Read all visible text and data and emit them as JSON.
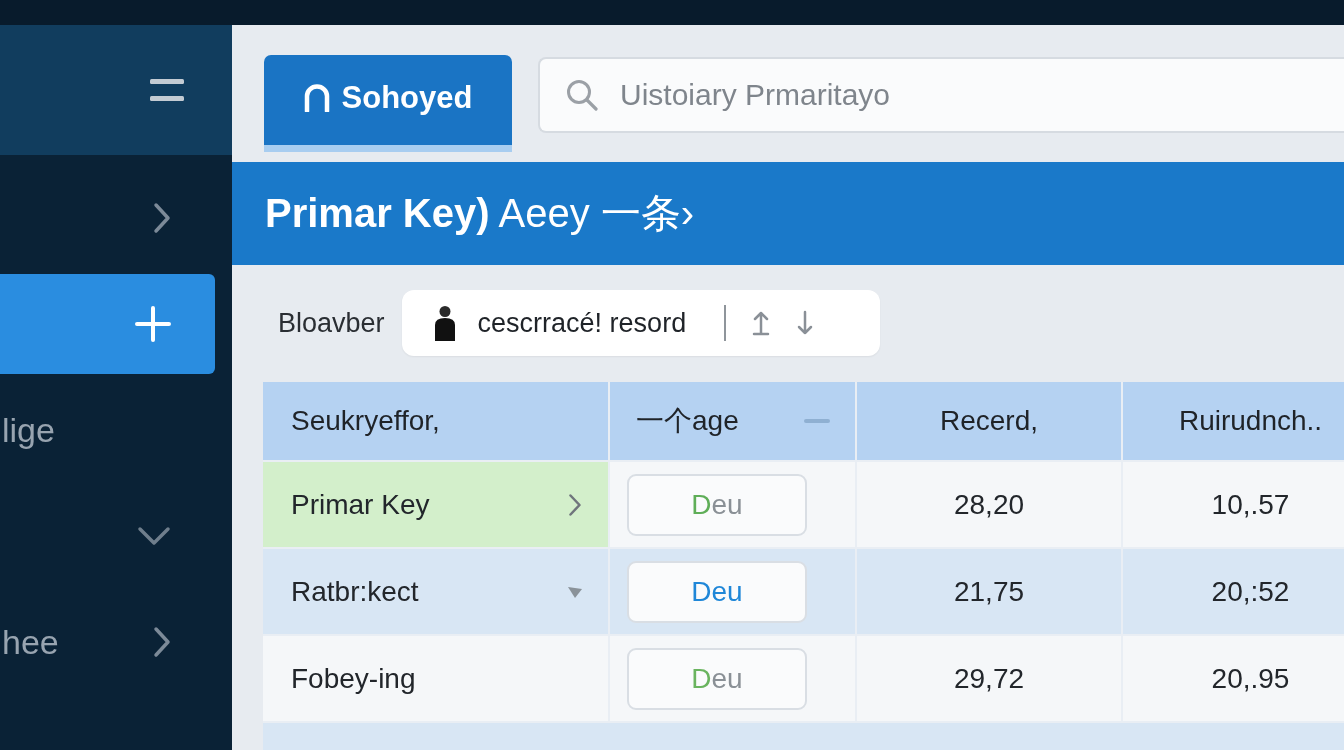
{
  "sidebar": {
    "items": [
      {
        "kind": "expand",
        "selected": false
      },
      {
        "kind": "add",
        "selected": true
      },
      {
        "label": "lige",
        "kind": "link",
        "selected": false
      },
      {
        "kind": "collapse",
        "selected": false
      },
      {
        "label": "hee",
        "kind": "expand",
        "selected": false
      }
    ]
  },
  "tabs": [
    {
      "label": "Sohoyed",
      "selected": true
    }
  ],
  "search": {
    "placeholder": "Uistoiary Prmaritayo"
  },
  "title": "**Primar Key)** Aeey 一条›",
  "toolbar": {
    "label": "Bloavber",
    "filter": {
      "value": "cescrracé! resord"
    }
  },
  "table": {
    "columns": [
      {
        "label": "Seukryeffor,",
        "kind": "plain"
      },
      {
        "label": "一个age",
        "kind": "collapsible"
      },
      {
        "label": "Recerd,",
        "kind": "plain"
      },
      {
        "label": "Ruirudnch..",
        "kind": "plain"
      }
    ],
    "rows": [
      {
        "kind": "expandable",
        "selected": true,
        "column_1": "Primar Key",
        "column_2": {
          "text": "Deu",
          "kind": "initial",
          "color": "#5fae58"
        },
        "column_3": "28,20",
        "column_4": "10,.57"
      },
      {
        "kind": "dropdown",
        "selected": false,
        "column_1": "Ratbr:kect",
        "column_2": {
          "text": "Deu",
          "kind": "full",
          "color": "#1f87d8"
        },
        "column_3": "21,75",
        "column_4": "20,:52"
      },
      {
        "kind": "plain",
        "selected": false,
        "column_1": "Fobey-ing",
        "column_2": {
          "text": "Deu",
          "kind": "initial",
          "color": "#6ab45f"
        },
        "column_3": "29,72",
        "column_4": "20,.95"
      }
    ]
  }
}
